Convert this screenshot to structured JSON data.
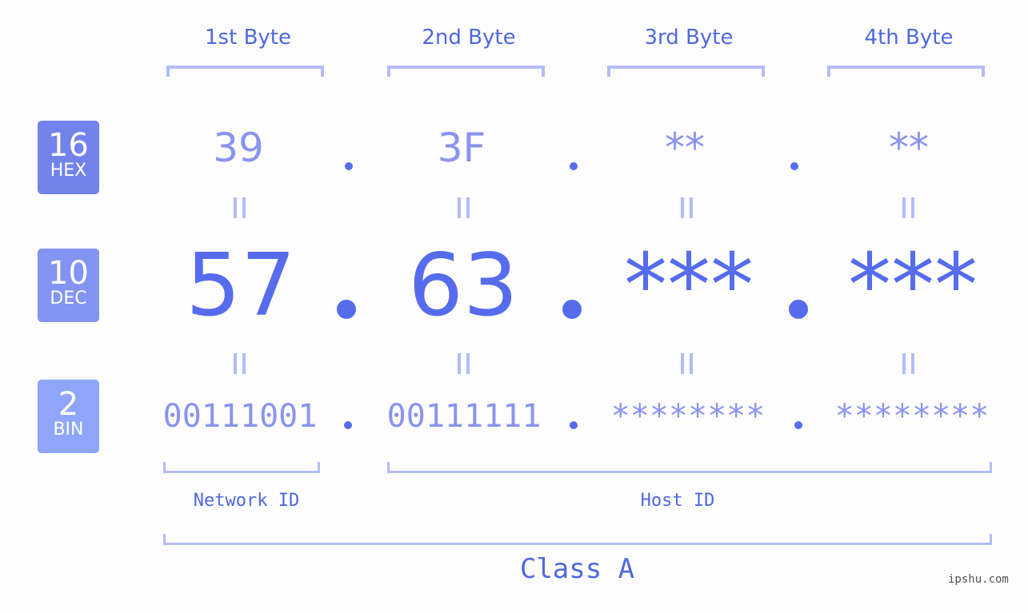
{
  "bytes": [
    {
      "label": "1st Byte",
      "hex": "39",
      "dec": "57",
      "bin": "00111001"
    },
    {
      "label": "2nd Byte",
      "hex": "3F",
      "dec": "63",
      "bin": "00111111"
    },
    {
      "label": "3rd Byte",
      "hex": "**",
      "dec": "***",
      "bin": "********"
    },
    {
      "label": "4th Byte",
      "hex": "**",
      "dec": "***",
      "bin": "********"
    }
  ],
  "badges": {
    "hex": {
      "num": "16",
      "unit": "HEX",
      "color": "#7383ec"
    },
    "dec": {
      "num": "10",
      "unit": "DEC",
      "color": "#8494f2"
    },
    "bin": {
      "num": "2",
      "unit": "BIN",
      "color": "#8fa6f8"
    }
  },
  "labels": {
    "network_id": "Network ID",
    "host_id": "Host ID",
    "class": "Class A"
  },
  "watermark": "ipshu.com",
  "colors": {
    "accent": "#566ced",
    "light_text": "#8b93ef",
    "bracket": "#b3bcf7"
  }
}
